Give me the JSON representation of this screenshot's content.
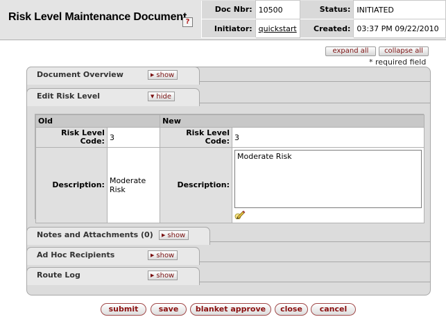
{
  "header": {
    "title": "Risk Level Maintenance Document",
    "help_icon": "?",
    "doc_nbr_label": "Doc Nbr:",
    "doc_nbr": "10500",
    "status_label": "Status:",
    "status": "INITIATED",
    "initiator_label": "Initiator:",
    "initiator": "quickstart",
    "created_label": "Created:",
    "created": "03:37 PM 09/22/2010"
  },
  "toolbar": {
    "expand_all": "expand all",
    "collapse_all": "collapse all",
    "required_note": "* required field"
  },
  "tabs": {
    "document_overview": {
      "label": "Document Overview",
      "toggle": "show"
    },
    "edit_risk_level": {
      "label": "Edit Risk Level",
      "toggle": "hide"
    },
    "notes": {
      "label": "Notes and Attachments (0)",
      "toggle": "show"
    },
    "adhoc": {
      "label": "Ad Hoc Recipients",
      "toggle": "show"
    },
    "route_log": {
      "label": "Route Log",
      "toggle": "show"
    }
  },
  "edit": {
    "old_header": "Old",
    "new_header": "New",
    "code_label": "Risk Level Code:",
    "old_code": "3",
    "new_code": "3",
    "desc_label": "Description:",
    "old_desc": "Moderate Risk",
    "new_desc": "Moderate Risk"
  },
  "actions": {
    "submit": "submit",
    "save": "save",
    "blanket_approve": "blanket approve",
    "close": "close",
    "cancel": "cancel"
  }
}
